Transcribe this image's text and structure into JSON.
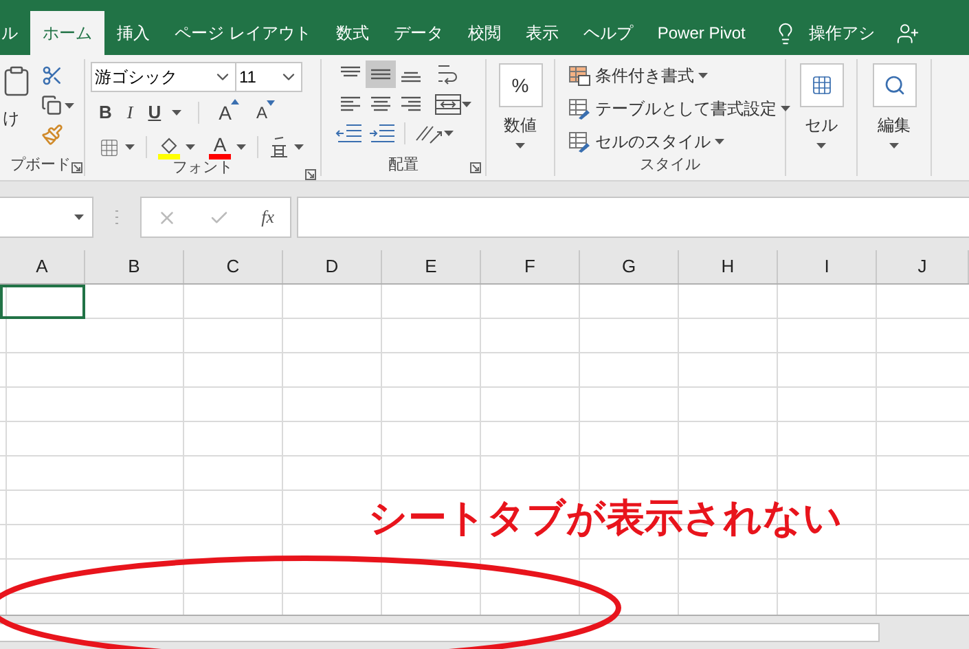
{
  "tabs": [
    {
      "label": "ル",
      "selected": false
    },
    {
      "label": "ホーム",
      "selected": true
    },
    {
      "label": "挿入",
      "selected": false
    },
    {
      "label": "ページ レイアウト",
      "selected": false
    },
    {
      "label": "数式",
      "selected": false
    },
    {
      "label": "データ",
      "selected": false
    },
    {
      "label": "校閲",
      "selected": false
    },
    {
      "label": "表示",
      "selected": false
    },
    {
      "label": "ヘルプ",
      "selected": false
    },
    {
      "label": "Power Pivot",
      "selected": false
    }
  ],
  "tell_me": "操作アシ",
  "ribbon": {
    "clipboard": {
      "paste_label": "け",
      "group_label": "プボード"
    },
    "font": {
      "font_name": "游ゴシック",
      "font_size": "11",
      "bold": "B",
      "italic": "I",
      "underline": "U",
      "grow": "A",
      "shrink": "A",
      "font_color": "A",
      "group_label": "フォント"
    },
    "alignment": {
      "vertical": [
        {
          "kind": "top",
          "selected": false
        },
        {
          "kind": "middle",
          "selected": true
        },
        {
          "kind": "bottom",
          "selected": false
        }
      ],
      "group_label": "配置"
    },
    "number": {
      "symbol": "%",
      "label": "数値"
    },
    "styles": {
      "items": [
        {
          "kind": "conditional",
          "label": "条件付き書式"
        },
        {
          "kind": "table",
          "label": "テーブルとして書式設定"
        },
        {
          "kind": "cell",
          "label": "セルのスタイル"
        }
      ],
      "group_label": "スタイル"
    },
    "cells": {
      "label": "セル"
    },
    "editing": {
      "label": "編集"
    }
  },
  "formula_bar": {
    "fx": "fx"
  },
  "columns": [
    {
      "label": "A",
      "active": true
    },
    {
      "label": "B",
      "active": false
    },
    {
      "label": "C",
      "active": false
    },
    {
      "label": "D",
      "active": false
    },
    {
      "label": "E",
      "active": false
    },
    {
      "label": "F",
      "active": false
    },
    {
      "label": "G",
      "active": false
    },
    {
      "label": "H",
      "active": false
    },
    {
      "label": "I",
      "active": false
    },
    {
      "label": "J",
      "active": false
    }
  ],
  "annotation": {
    "text": "シートタブが表示されない"
  }
}
